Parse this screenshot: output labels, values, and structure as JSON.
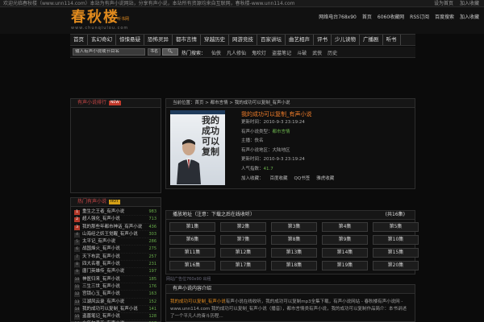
{
  "topbar": {
    "welcome": "欢迎光临春秋楼（www.unn114.com）本站为有声小说网站，分享有声小说，本站所有资源均来自互联网，春秋楼-www.unn114.com",
    "links": [
      "设为首页",
      "加入收藏"
    ]
  },
  "header": {
    "logo_text": "春秋楼",
    "logo_sub": "听书网",
    "logo_url": "www.chunqiulou.com",
    "links": [
      "网络电台768x90",
      "首页",
      "6060收藏网",
      "RSS订阅",
      "百度搜索",
      "加入收藏"
    ]
  },
  "nav": {
    "items": [
      "首页",
      "玄幻奇幻",
      "惊悚悬疑",
      "恐怖灵异",
      "都市言情",
      "穿越历史",
      "网游竞技",
      "百家讲坛",
      "曲艺相声",
      "评书",
      "少儿读物",
      "广播剧",
      "听书"
    ]
  },
  "search": {
    "placeholder": "输入有声小说或节目名",
    "select": "书名",
    "hot_label": "热门搜索：",
    "hot": [
      "仙侠",
      "凡人修仙",
      "鬼吹灯",
      "盗墓笔记",
      "斗破",
      "武侠",
      "历史"
    ]
  },
  "sidebar": {
    "recent_title": "有声小说排行",
    "recent_tag": "NEW",
    "rank_title": "热门有声小说",
    "rank_tag": "HOT",
    "items": [
      {
        "n": "1",
        "title": "重生之王者_有声小说",
        "count": "983"
      },
      {
        "n": "2",
        "title": "超人强化_有声小说",
        "count": "713"
      },
      {
        "n": "3",
        "title": "我的那些年都市神话_有声小说",
        "count": "436"
      },
      {
        "n": "4",
        "title": "山海经之妖王觉醒_有声小说",
        "count": "303"
      },
      {
        "n": "5",
        "title": "太平记_有声小说",
        "count": "286"
      },
      {
        "n": "6",
        "title": "战国烽火_有声小说",
        "count": "275"
      },
      {
        "n": "7",
        "title": "天下布武_有声小说",
        "count": "257"
      },
      {
        "n": "8",
        "title": "四大名著_有声小说",
        "count": "231"
      },
      {
        "n": "9",
        "title": "唐门英雄传_有声小说",
        "count": "197"
      },
      {
        "n": "10",
        "title": "神医归来_有声小说",
        "count": "185"
      },
      {
        "n": "11",
        "title": "三生三世_有声小说",
        "count": "176"
      },
      {
        "n": "12",
        "title": "宫锁心玉_有声小说",
        "count": "163"
      },
      {
        "n": "13",
        "title": "江湖风云录_有声小说",
        "count": "152"
      },
      {
        "n": "14",
        "title": "我的成功可以复制_有声小说",
        "count": "141"
      },
      {
        "n": "15",
        "title": "盗墓笔记_有声小说",
        "count": "128"
      },
      {
        "n": "16",
        "title": "少年包青天_有声小说",
        "count": "117"
      },
      {
        "n": "17",
        "title": "英雄联盟_有声小说",
        "count": "104"
      }
    ]
  },
  "detail": {
    "crumb": "当前位置：首页 > 都市言情 > 我的成功可以复制_有声小说",
    "cover_title": "我的成功可以复制",
    "title": "我的成功可以复制_有声小说",
    "rows": [
      {
        "label": "更新时间：",
        "value": "2010-9-3 23:19:24"
      },
      {
        "label": "有声小说类型：",
        "value": "都市言情"
      },
      {
        "label": "主播：",
        "value": "佚名"
      },
      {
        "label": "有声小说地区：",
        "value": "大陆地区"
      },
      {
        "label": "更新时间：",
        "value": "2010-9-3 23:19:24"
      },
      {
        "label": "人气指数：",
        "value": "41.7"
      }
    ],
    "actions": [
      "加入收藏：",
      "百度收藏",
      "QQ书签",
      "雅虎收藏"
    ]
  },
  "episodes": {
    "title": "播放地址（注意：下载之后在线收听）",
    "total": "(共16集)",
    "items": [
      "第1集",
      "第2集",
      "第3集",
      "第4集",
      "第5集",
      "第6集",
      "第7集",
      "第8集",
      "第9集",
      "第10集",
      "第11集",
      "第12集",
      "第13集",
      "第14集",
      "第15集",
      "第16集",
      "第17集",
      "第18集",
      "第19集",
      "第20集"
    ]
  },
  "ad": "网站广告位760x90 出租",
  "intro": {
    "title": "有声小说内容介绍",
    "text_hl": "我的成功可以复制_有声小说",
    "text": "有声小说在线收听，我的成功可以复制mp3全集下载，有声小说网站 - 春秋楼有声小说网 - www.unn114.com 我的成功可以复制_有声小说（播音），都市言情类有声小说，我的成功可以复制作品简介：本书讲述了一个平凡人的奋斗历程..."
  }
}
